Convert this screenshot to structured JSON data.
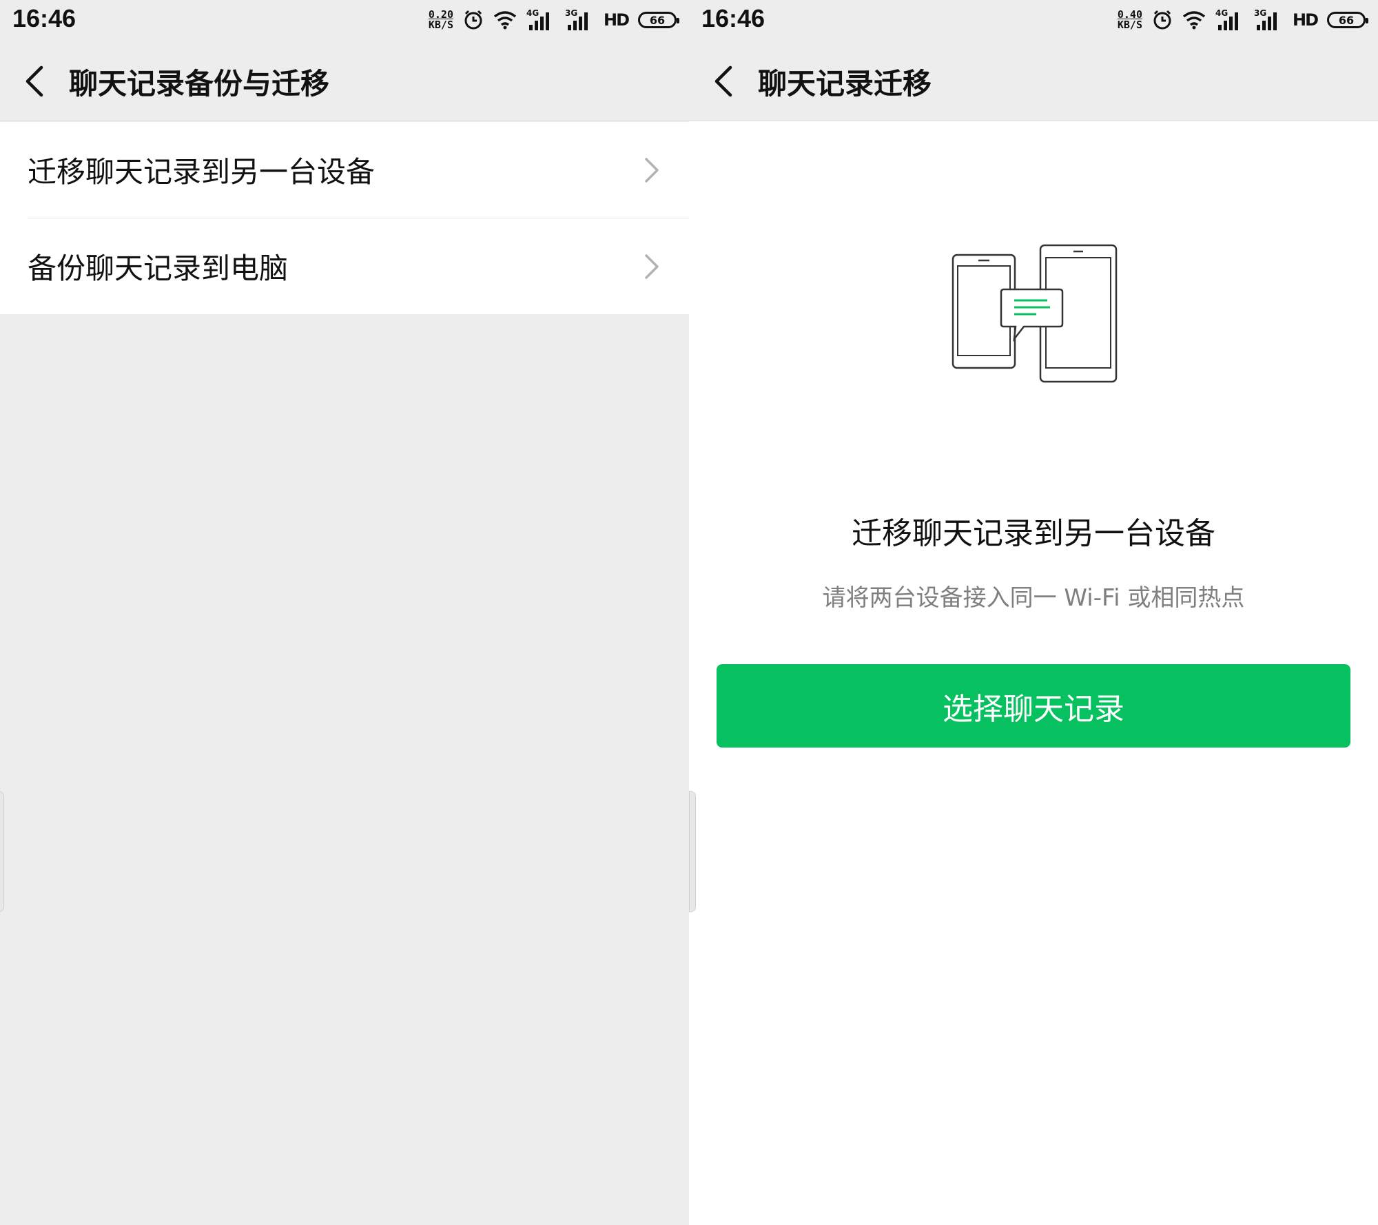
{
  "left": {
    "status": {
      "time": "16:46",
      "speed_value": "0.20",
      "speed_unit": "KB/S",
      "net1": "4G",
      "net2": "3G",
      "hd": "HD",
      "battery": "66"
    },
    "nav": {
      "title": "聊天记录备份与迁移"
    },
    "items": [
      {
        "label": "迁移聊天记录到另一台设备"
      },
      {
        "label": "备份聊天记录到电脑"
      }
    ]
  },
  "right": {
    "status": {
      "time": "16:46",
      "speed_value": "0.40",
      "speed_unit": "KB/S",
      "net1": "4G",
      "net2": "3G",
      "hd": "HD",
      "battery": "66"
    },
    "nav": {
      "title": "聊天记录迁移"
    },
    "heading": "迁移聊天记录到另一台设备",
    "subtext": "请将两台设备接入同一 Wi-Fi 或相同热点",
    "button_label": "选择聊天记录"
  },
  "colors": {
    "accent": "#07c160",
    "background": "#ededed",
    "panel": "#ffffff",
    "muted_text": "#7f7f7f"
  },
  "icons": [
    "back-arrow-icon",
    "chevron-right-icon",
    "alarm-icon",
    "wifi-icon",
    "signal-icon",
    "battery-icon",
    "phone-transfer-illustration"
  ]
}
